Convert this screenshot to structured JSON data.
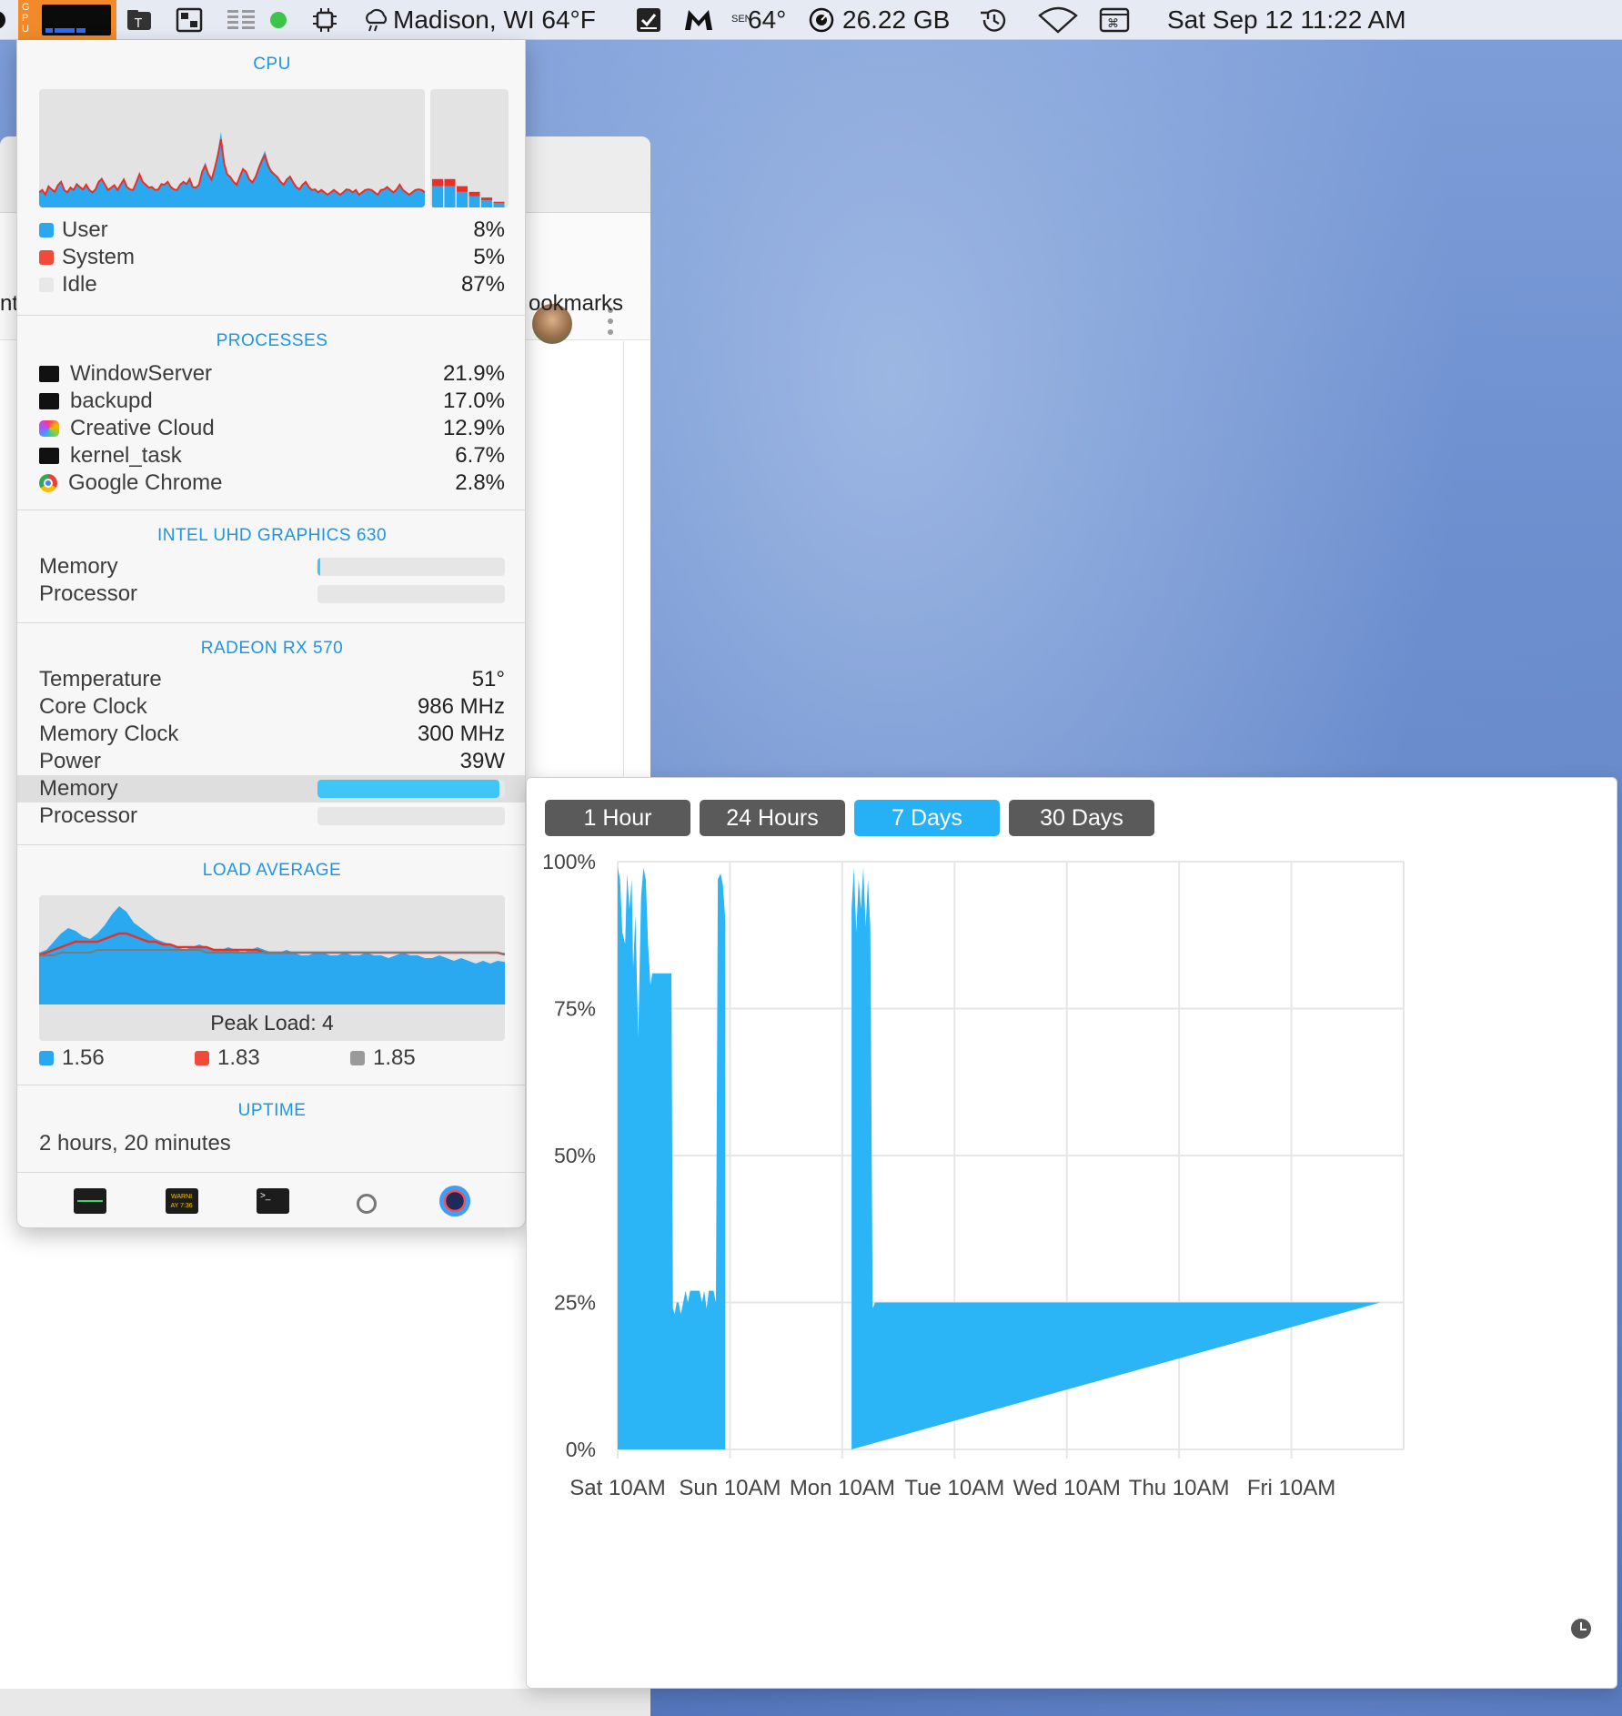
{
  "menubar": {
    "gpu_label": "GPU",
    "weather": "Madison, WI 64°F",
    "temp": "64°",
    "sensor_letters": "SEN",
    "disk": "26.22 GB",
    "datetime": "Sat Sep 12  11:22 AM"
  },
  "background_window": {
    "bookmarks": "ookmarks",
    "edge_text": "nt:"
  },
  "panel": {
    "cpu": {
      "title": "CPU",
      "rows": [
        {
          "label": "User",
          "value": "8%",
          "color": "#29a8f0"
        },
        {
          "label": "System",
          "value": "5%",
          "color": "#f04a3a"
        },
        {
          "label": "Idle",
          "value": "87%",
          "color": "#e8e8e8"
        }
      ],
      "history_user": [
        8,
        9,
        7,
        12,
        10,
        9,
        11,
        14,
        9,
        8,
        10,
        9,
        13,
        11,
        10,
        12,
        9,
        8,
        10,
        14,
        16,
        12,
        9,
        10,
        11,
        9,
        12,
        15,
        11,
        10,
        9,
        13,
        18,
        14,
        12,
        10,
        11,
        9,
        10,
        13,
        12,
        14,
        11,
        10,
        9,
        12,
        14,
        13,
        16,
        11,
        10,
        12,
        20,
        24,
        18,
        15,
        22,
        30,
        40,
        25,
        18,
        16,
        14,
        12,
        17,
        21,
        19,
        15,
        13,
        16,
        22,
        26,
        30,
        24,
        20,
        18,
        16,
        14,
        12,
        15,
        17,
        13,
        11,
        10,
        12,
        14,
        11,
        9,
        10,
        8,
        9,
        8,
        7,
        8,
        9,
        8,
        7,
        8,
        10,
        9,
        8,
        9,
        7,
        8,
        9,
        10,
        9,
        8,
        7,
        9,
        10,
        11,
        9,
        8,
        10,
        12,
        9,
        8,
        7,
        8,
        9,
        10,
        9,
        8
      ],
      "history_system": [
        6,
        7,
        5,
        8,
        7,
        6,
        9,
        10,
        7,
        6,
        8,
        7,
        9,
        8,
        7,
        9,
        7,
        6,
        7,
        10,
        11,
        9,
        7,
        8,
        9,
        7,
        9,
        11,
        8,
        7,
        7,
        10,
        13,
        10,
        9,
        8,
        8,
        7,
        7,
        9,
        9,
        10,
        8,
        7,
        7,
        9,
        10,
        9,
        11,
        8,
        8,
        9,
        14,
        16,
        13,
        11,
        15,
        20,
        26,
        17,
        13,
        12,
        10,
        9,
        12,
        15,
        14,
        11,
        10,
        12,
        15,
        18,
        20,
        16,
        14,
        13,
        12,
        10,
        9,
        11,
        12,
        10,
        8,
        7,
        9,
        10,
        8,
        7,
        7,
        6,
        7,
        6,
        5,
        6,
        7,
        6,
        5,
        6,
        7,
        7,
        6,
        7,
        5,
        6,
        7,
        7,
        7,
        6,
        5,
        7,
        7,
        8,
        7,
        6,
        7,
        9,
        7,
        6,
        5,
        6,
        7,
        7,
        7,
        6
      ],
      "mini_bars": [
        {
          "user": 15,
          "system": 5
        },
        {
          "user": 15,
          "system": 5
        },
        {
          "user": 11,
          "system": 4
        },
        {
          "user": 8,
          "system": 3
        },
        {
          "user": 5,
          "system": 2
        },
        {
          "user": 3,
          "system": 1
        }
      ]
    },
    "processes": {
      "title": "PROCESSES",
      "rows": [
        {
          "name": "WindowServer",
          "value": "21.9%",
          "icon": "terminal-icon"
        },
        {
          "name": "backupd",
          "value": "17.0%",
          "icon": "terminal-icon"
        },
        {
          "name": "Creative Cloud",
          "value": "12.9%",
          "icon": "creative-cloud-icon"
        },
        {
          "name": "kernel_task",
          "value": "6.7%",
          "icon": "terminal-icon"
        },
        {
          "name": "Google Chrome",
          "value": "2.8%",
          "icon": "chrome-icon"
        }
      ]
    },
    "intel": {
      "title": "INTEL UHD GRAPHICS 630",
      "memory_label": "Memory",
      "memory_fraction": 0.01,
      "processor_label": "Processor",
      "processor_fraction": 0.0
    },
    "radeon": {
      "title": "RADEON RX 570",
      "rows": [
        {
          "label": "Temperature",
          "value": "51°"
        },
        {
          "label": "Core Clock",
          "value": "986 MHz"
        },
        {
          "label": "Memory Clock",
          "value": "300 MHz"
        },
        {
          "label": "Power",
          "value": "39W"
        }
      ],
      "memory_label": "Memory",
      "memory_fraction": 0.97,
      "processor_label": "Processor",
      "processor_fraction": 0.0
    },
    "load": {
      "title": "LOAD AVERAGE",
      "peak": "Peak Load: 4",
      "values": [
        {
          "value": "1.56",
          "color": "#29a8f0"
        },
        {
          "value": "1.83",
          "color": "#f04a3a"
        },
        {
          "value": "1.85",
          "color": "#9a9a9a"
        }
      ],
      "history_1m": [
        1.9,
        2.0,
        2.3,
        2.6,
        2.8,
        2.7,
        2.5,
        2.4,
        2.6,
        2.9,
        3.3,
        3.6,
        3.4,
        3.0,
        2.8,
        2.6,
        2.4,
        2.3,
        2.2,
        2.1,
        2.0,
        2.1,
        2.2,
        2.1,
        2.0,
        2.0,
        2.1,
        2.0,
        1.9,
        2.0,
        2.1,
        2.0,
        1.9,
        1.9,
        2.0,
        1.9,
        1.8,
        1.8,
        1.9,
        1.9,
        1.8,
        1.8,
        1.9,
        1.8,
        1.8,
        1.9,
        1.8,
        1.8,
        1.7,
        1.8,
        1.9,
        1.8,
        1.8,
        1.7,
        1.7,
        1.8,
        1.7,
        1.6,
        1.7,
        1.6,
        1.5,
        1.6,
        1.5,
        1.6,
        1.56
      ],
      "history_5m": [
        1.8,
        1.9,
        2.0,
        2.1,
        2.2,
        2.3,
        2.3,
        2.3,
        2.3,
        2.4,
        2.5,
        2.6,
        2.6,
        2.5,
        2.4,
        2.3,
        2.3,
        2.2,
        2.2,
        2.1,
        2.1,
        2.1,
        2.1,
        2.1,
        2.0,
        2.0,
        2.0,
        2.0,
        2.0,
        2.0,
        2.0,
        1.9,
        1.9,
        1.9,
        1.9,
        1.9,
        1.9,
        1.9,
        1.9,
        1.9,
        1.9,
        1.9,
        1.9,
        1.9,
        1.9,
        1.9,
        1.9,
        1.9,
        1.9,
        1.9,
        1.9,
        1.9,
        1.9,
        1.9,
        1.9,
        1.9,
        1.9,
        1.9,
        1.9,
        1.9,
        1.9,
        1.9,
        1.9,
        1.9,
        1.83
      ],
      "history_15m": [
        1.8,
        1.8,
        1.8,
        1.9,
        1.9,
        1.9,
        1.9,
        1.9,
        2.0,
        2.0,
        2.0,
        2.0,
        2.0,
        2.0,
        2.0,
        2.0,
        2.0,
        2.0,
        2.0,
        2.0,
        2.0,
        2.0,
        2.0,
        1.9,
        1.9,
        1.9,
        1.9,
        1.9,
        1.9,
        1.9,
        1.9,
        1.9,
        1.9,
        1.9,
        1.9,
        1.9,
        1.9,
        1.9,
        1.9,
        1.9,
        1.9,
        1.9,
        1.9,
        1.9,
        1.9,
        1.9,
        1.9,
        1.9,
        1.9,
        1.9,
        1.9,
        1.9,
        1.9,
        1.9,
        1.9,
        1.9,
        1.9,
        1.9,
        1.9,
        1.9,
        1.9,
        1.9,
        1.9,
        1.9,
        1.85
      ],
      "ymax": 4
    },
    "uptime": {
      "title": "UPTIME",
      "value": "2 hours, 20 minutes"
    },
    "footer_icons": [
      "activity-monitor-icon",
      "console-icon",
      "terminal-icon",
      "disk-utility-icon",
      "istat-icon"
    ],
    "footer_console_text": "WARNI\nAY 7:36"
  },
  "history_panel": {
    "tabs": [
      {
        "label": "1 Hour",
        "active": false
      },
      {
        "label": "24 Hours",
        "active": false
      },
      {
        "label": "7 Days",
        "active": true
      },
      {
        "label": "30 Days",
        "active": false
      }
    ]
  },
  "chart_data": {
    "type": "area",
    "ylabel": "",
    "xlabel": "",
    "y_ticks": [
      "100%",
      "75%",
      "50%",
      "25%",
      "0%"
    ],
    "ylim": [
      0,
      100
    ],
    "x_ticks": [
      "Sat 10AM",
      "Sun 10AM",
      "Mon 10AM",
      "Tue 10AM",
      "Wed 10AM",
      "Thu 10AM",
      "Fri 10AM"
    ],
    "xlim": [
      0,
      168
    ],
    "x_tick_positions_hours": [
      0,
      24,
      48,
      72,
      96,
      120,
      144
    ],
    "grid": true,
    "color": "#2bb5f7",
    "series": [
      {
        "segments": [
          {
            "x": [
              0,
              0.5,
              1,
              1.6,
              2,
              2.5,
              3,
              3.3,
              3.8,
              4.4,
              5,
              5.5,
              6,
              6.5,
              7,
              7.4,
              8,
              8.5,
              9,
              9.5,
              10,
              10.5,
              11,
              11.5,
              11.8,
              12.2,
              12.6,
              13,
              13.5,
              14,
              14.5,
              15,
              15.5,
              16,
              16.5,
              17,
              17.5,
              18,
              18.5,
              19,
              19.5,
              20,
              20.5,
              21,
              21.4,
              22,
              22.5,
              23
            ],
            "y": [
              99,
              97,
              88,
              86,
              98,
              92,
              97,
              82,
              91,
              70,
              94,
              99,
              97,
              86,
              79,
              81,
              81,
              81,
              81,
              81,
              81,
              81,
              81,
              81,
              24,
              23,
              25,
              25,
              23,
              25,
              27,
              25,
              27,
              27,
              27,
              27,
              27,
              25,
              27,
              24,
              27,
              27,
              27,
              25,
              97,
              98,
              96,
              90
            ]
          },
          {
            "x": [
              50,
              50.5,
              51,
              51.5,
              52,
              52.5,
              53,
              53.5,
              54,
              54.5,
              55,
              55.5,
              56,
              56.5,
              57,
              57.5,
              58,
              58.5,
              59,
              59.5,
              60,
              61,
              62,
              63,
              64,
              65,
              66,
              67,
              68,
              69,
              70,
              71,
              72,
              73,
              73.5,
              74,
              74.5,
              75,
              75.5,
              76,
              76.5,
              77,
              77.5,
              78,
              78.5,
              79,
              79.5,
              80,
              80.5,
              81,
              81.5,
              82,
              82.5,
              83,
              83.5,
              84,
              84.5,
              85,
              85.5,
              86,
              86.5,
              87,
              87.5,
              88,
              89,
              90,
              91,
              92,
              93,
              94,
              95,
              96,
              97,
              98,
              99,
              100,
              100.5,
              101,
              101.5,
              102,
              102.5,
              103,
              103.5,
              104,
              104.5,
              105,
              105.5,
              106,
              106.5,
              107,
              107.5,
              108,
              108.5,
              109,
              109.5,
              110,
              110.5,
              111,
              111.5,
              112,
              112.5,
              113,
              113.5,
              114,
              114.5,
              115,
              115.5,
              116,
              116.5,
              117,
              117.5,
              118,
              118.5,
              119,
              119.5,
              120,
              120.5,
              121,
              121.5,
              122,
              122.5,
              123,
              123.5,
              124,
              124.5,
              125,
              125.5,
              126,
              126.5,
              127,
              127.5,
              128,
              128.5,
              129,
              129.5,
              130,
              130.5,
              131,
              131.5,
              132,
              132.5,
              133,
              133.5,
              134,
              134.5,
              135,
              135.5,
              136,
              136.5,
              137,
              137.5,
              138,
              138.5,
              139,
              139.5,
              140,
              140.5,
              141,
              141.5,
              142,
              142.5,
              143,
              143.5,
              144,
              144.5,
              145,
              145.5,
              146,
              146.5,
              147,
              147.5,
              148,
              148.5,
              149,
              149.5,
              150,
              150.5,
              151,
              151.5,
              152,
              152.5,
              153,
              153.5,
              154,
              154.5,
              155,
              155.5,
              156,
              156.5,
              157,
              157.5,
              158,
              158.5,
              159,
              159.5,
              160,
              160.5,
              161,
              161.5,
              162,
              162.5,
              163,
              163.5,
              164,
              164.5,
              165,
              165.5,
              166,
              166.5,
              167,
              167.5
            ],
            "y": [
              92,
              99,
              88,
              97,
              92,
              99,
              89,
              97,
              89,
              24,
              25,
              25,
              25,
              25,
              25,
              25,
              25,
              25,
              25,
              25,
              25,
              25,
              25,
              25,
              25,
              25,
              25,
              25,
              25,
              25,
              25,
              25,
              25,
              25,
              25,
              25,
              25,
              25,
              25,
              25,
              25,
              25,
              25,
              25,
              25,
              25,
              25,
              25,
              25,
              25,
              25,
              25,
              25,
              25,
              25,
              25,
              25,
              25,
              25,
              25,
              25,
              25,
              25,
              25,
              25,
              25,
              25,
              25,
              25,
              25,
              25,
              25,
              25,
              25,
              25,
              25,
              25,
              25,
              25,
              25,
              25,
              25,
              25,
              25,
              25,
              25,
              25,
              25,
              25,
              25,
              25,
              25,
              25,
              25,
              25,
              25,
              25,
              25,
              25,
              25,
              25,
              25,
              25,
              25,
              25,
              25,
              25,
              25,
              25,
              25,
              25,
              25,
              25,
              25,
              25,
              25,
              25,
              25,
              25,
              25,
              25,
              25,
              25,
              25,
              25,
              25,
              25,
              25,
              25,
              25,
              25,
              25,
              25,
              25,
              25,
              25,
              25,
              25,
              25,
              25,
              25,
              25,
              25,
              25,
              25,
              25,
              25,
              25,
              25,
              25,
              25,
              25,
              25,
              25,
              25,
              25,
              25,
              25,
              25,
              25,
              25,
              25,
              25,
              25,
              25,
              25,
              25,
              25,
              25,
              25,
              25,
              25,
              25,
              25,
              25,
              25,
              25,
              25,
              25,
              25,
              25,
              25,
              25,
              25,
              25,
              25,
              25,
              25,
              25,
              25,
              25,
              25,
              25,
              25,
              25,
              25,
              25,
              25,
              25,
              25,
              25,
              25
            ]
          }
        ]
      }
    ]
  }
}
